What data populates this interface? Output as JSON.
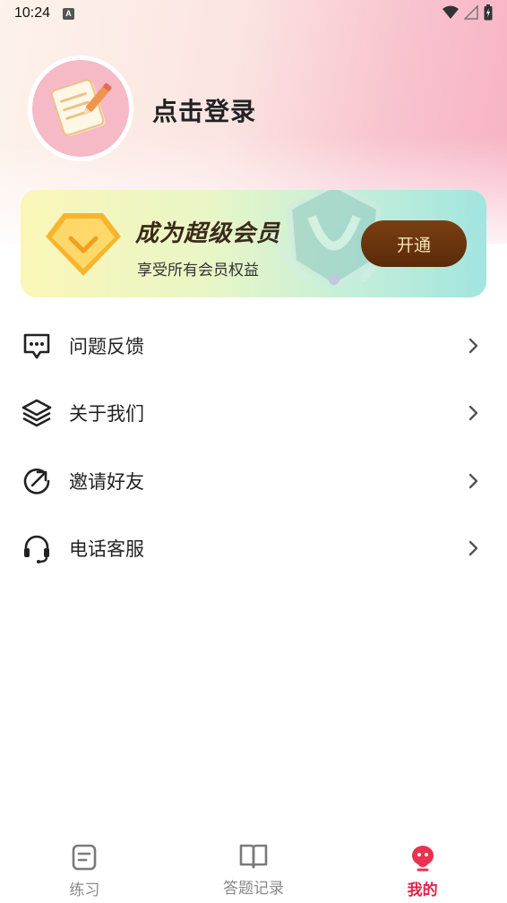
{
  "status_bar": {
    "time": "10:24",
    "notification_glyph": "A"
  },
  "profile": {
    "login_text": "点击登录",
    "avatar_icon": "notebook-pencil-icon"
  },
  "vip": {
    "title": "成为超级会员",
    "subtitle": "享受所有会员权益",
    "button_label": "开通",
    "accent_color": "#5a2b08"
  },
  "menu": {
    "items": [
      {
        "label": "问题反馈",
        "icon": "chat-bubble-icon"
      },
      {
        "label": "关于我们",
        "icon": "layers-icon"
      },
      {
        "label": "邀请好友",
        "icon": "share-arrow-icon"
      },
      {
        "label": "电话客服",
        "icon": "headset-icon"
      }
    ]
  },
  "bottom_nav": {
    "items": [
      {
        "label": "练习",
        "icon": "note-icon",
        "active": false
      },
      {
        "label": "答题记录",
        "icon": "book-icon",
        "active": false
      },
      {
        "label": "我的",
        "icon": "profile-icon",
        "active": true
      }
    ],
    "active_color": "#e0234a"
  }
}
